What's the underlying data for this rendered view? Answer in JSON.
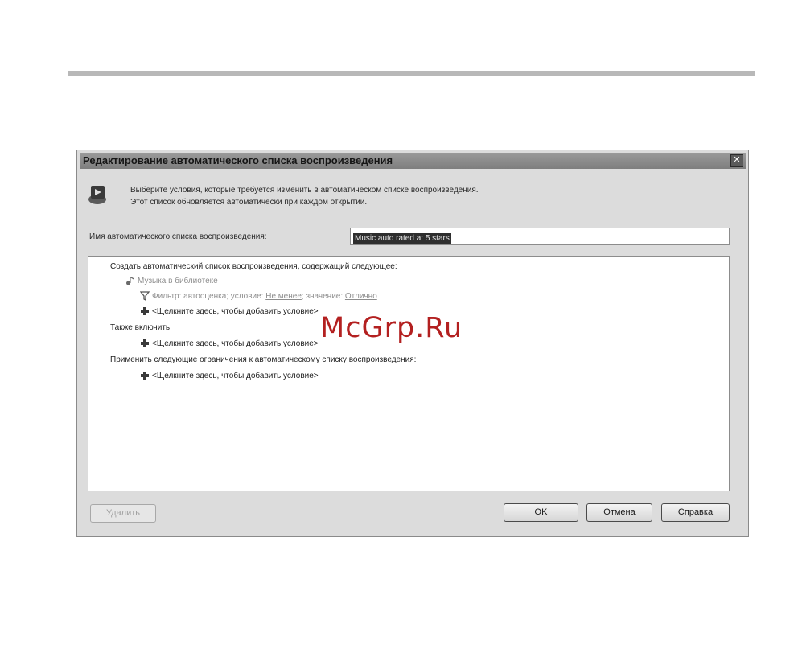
{
  "dialog": {
    "title": "Редактирование автоматического списка воспроизведения",
    "close_label": "✕",
    "intro_line1": "Выберите условия, которые требуется изменить в автоматическом списке воспроизведения.",
    "intro_line2": "Этот список обновляется автоматически при каждом открытии."
  },
  "name_field": {
    "label": "Имя автоматического списка воспроизведения:",
    "value": "Music auto rated at 5 stars"
  },
  "rules": {
    "create_heading": "Создать автоматический список воспроизведения, содержащий следующее:",
    "library_item": "Музыка в библиотеке",
    "filter_prefix": "Фильтр: автооценка; условие:",
    "filter_condition": "Не менее",
    "filter_mid": "; значение:",
    "filter_value": "Отлично",
    "add_condition_1": "<Щелкните здесь, чтобы добавить условие>",
    "also_include": "Также включить:",
    "add_condition_2": "<Щелкните здесь, чтобы добавить условие>",
    "limits_heading": "Применить следующие ограничения к автоматическому списку воспроизведения:",
    "add_condition_3": "<Щелкните здесь, чтобы добавить условие>"
  },
  "buttons": {
    "delete": "Удалить",
    "ok": "OK",
    "cancel": "Отмена",
    "help": "Справка"
  },
  "watermark": "McGrp.Ru"
}
